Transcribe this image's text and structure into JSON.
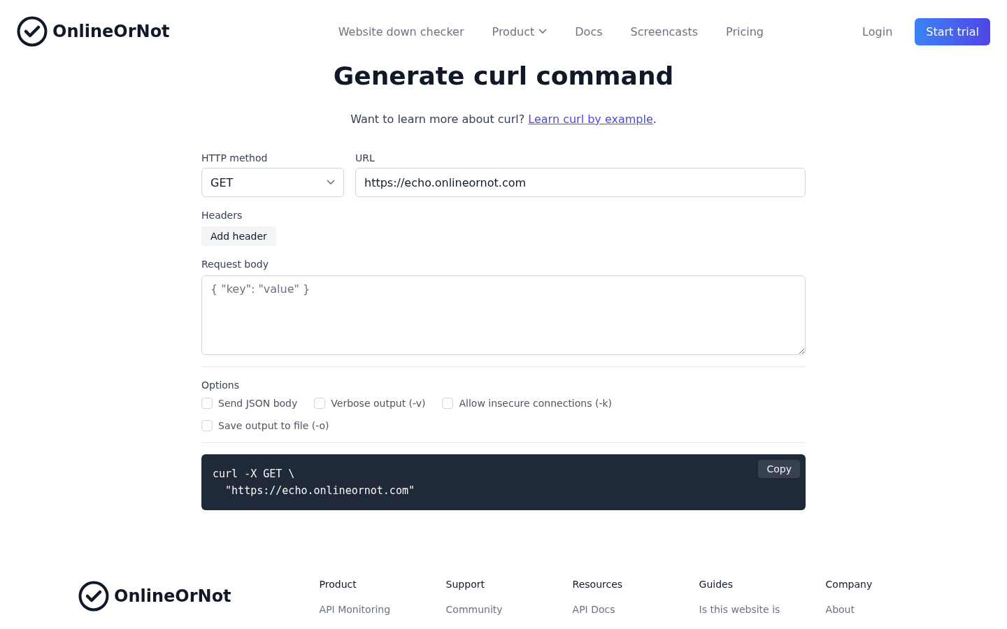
{
  "header": {
    "logo": "OnlineOrNot",
    "nav": [
      {
        "label": "Website down checker",
        "dropdown": false
      },
      {
        "label": "Product",
        "dropdown": true
      },
      {
        "label": "Docs",
        "dropdown": false
      },
      {
        "label": "Screencasts",
        "dropdown": false
      },
      {
        "label": "Pricing",
        "dropdown": false
      }
    ],
    "login": "Login",
    "cta": "Start trial"
  },
  "title": "Generate curl command",
  "intro": {
    "text": "Want to learn more about curl?",
    "link": "Learn curl by example",
    "after": "."
  },
  "form": {
    "method": {
      "label": "HTTP method",
      "value": "GET"
    },
    "url": {
      "label": "URL",
      "value": "https://echo.onlineornot.com"
    },
    "headers": {
      "label": "Headers",
      "button": "Add header"
    },
    "body": {
      "label": "Request body",
      "placeholder": "{ \"key\": \"value\" }"
    },
    "options": {
      "label": "Options",
      "items": [
        {
          "label": "Send JSON body",
          "checked": false
        },
        {
          "label": "Verbose output (-v)",
          "checked": false
        },
        {
          "label": "Allow insecure connections (-k)",
          "checked": false
        },
        {
          "label": "Save output to file (-o)",
          "checked": false
        }
      ]
    }
  },
  "output": {
    "lines": [
      "curl -X GET \\",
      "  \"https://echo.onlineornot.com\""
    ],
    "copy": "Copy"
  },
  "footer": {
    "logo": "OnlineOrNot",
    "columns": [
      {
        "heading": "Product",
        "links": [
          "API Monitoring"
        ]
      },
      {
        "heading": "Support",
        "links": [
          "Community"
        ]
      },
      {
        "heading": "Resources",
        "links": [
          "API Docs"
        ]
      },
      {
        "heading": "Guides",
        "links": [
          "Is this website is"
        ]
      },
      {
        "heading": "Company",
        "links": [
          "About"
        ]
      }
    ]
  }
}
